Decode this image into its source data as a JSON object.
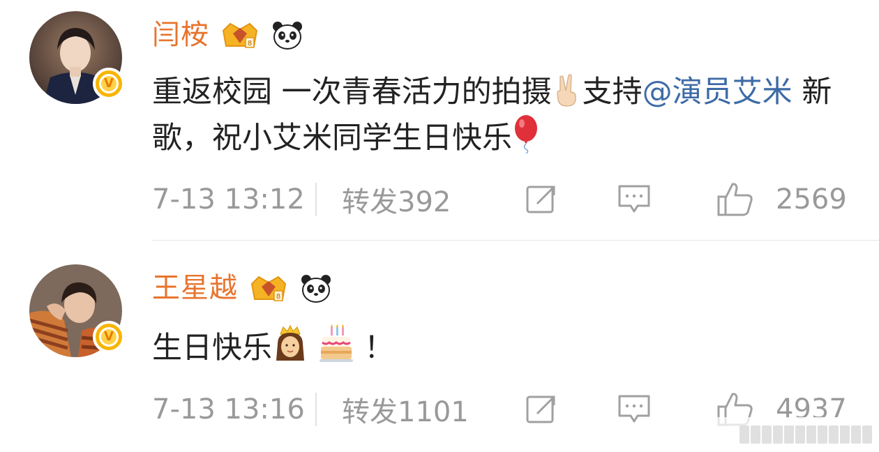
{
  "comments": [
    {
      "username": "闫桉",
      "content_parts": [
        "重返校园 一次青春活力的拍摄",
        "支持",
        "@演员艾米",
        " 新歌，祝小艾米同学生日快乐"
      ],
      "time": "7-13 13:12",
      "repost_label": "转发",
      "repost_count": "392",
      "like_count": "2569",
      "icons": [
        "crown-badge-icon",
        "panda-badge-icon",
        "victory-hand-emoji",
        "balloon-emoji",
        "share-icon",
        "comment-icon",
        "like-icon"
      ]
    },
    {
      "username": "王星越",
      "content_parts": [
        "生日快乐",
        "！"
      ],
      "time": "7-13 13:16",
      "repost_label": "转发",
      "repost_count": "1101",
      "like_count": "4937",
      "icons": [
        "crown-badge-icon",
        "panda-badge-icon",
        "princess-emoji",
        "birthday-cake-emoji",
        "share-icon",
        "comment-icon",
        "like-icon"
      ]
    }
  ],
  "colors": {
    "username": "#e8742d",
    "mention": "#3d6ba6",
    "meta": "#999999",
    "verify_badge": "#f7b500"
  }
}
